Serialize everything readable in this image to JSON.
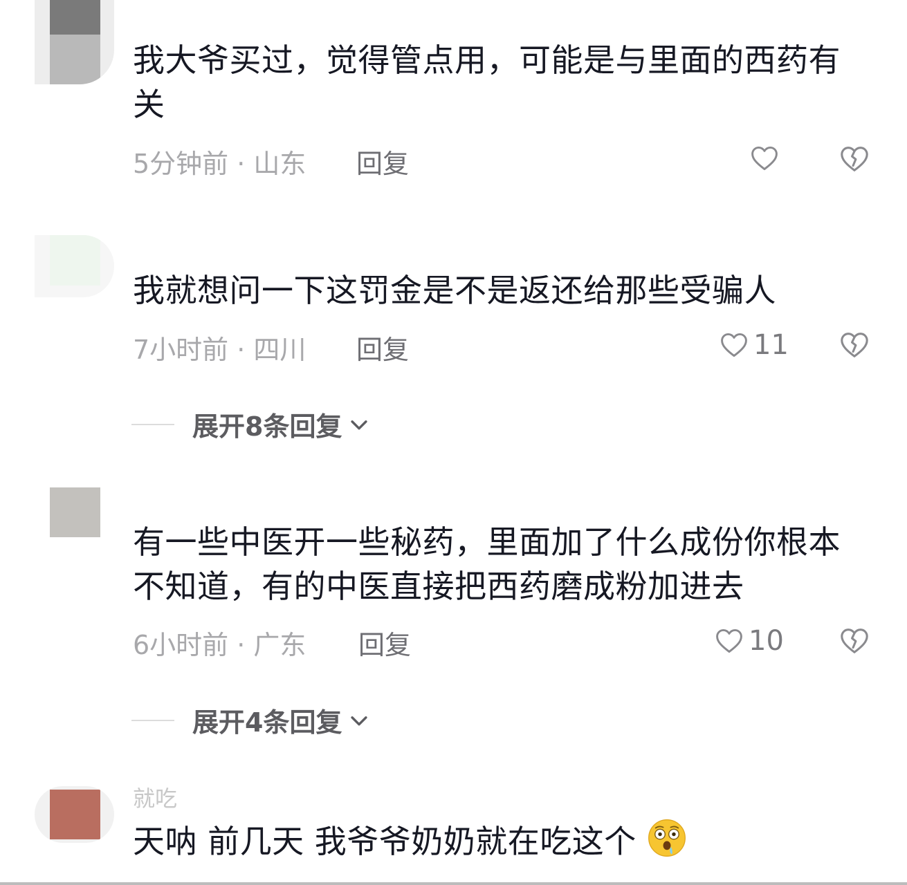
{
  "comments": [
    {
      "avatar_color": "#7a7a7a",
      "username": "",
      "text": "我大爷买过，觉得管点用，可能是与里面的西药有关",
      "time": "5分钟前",
      "location": "山东",
      "meta": "5分钟前 · 山东",
      "reply_label": "回复",
      "likes": "",
      "liked": false
    },
    {
      "avatar_color": "#eef6ee",
      "username": "",
      "text": "我就想问一下这罚金是不是返还给那些受骗人",
      "time": "7小时前",
      "location": "四川",
      "meta": "7小时前 · 四川",
      "reply_label": "回复",
      "likes": "11",
      "liked": false,
      "expand_label": "展开8条回复"
    },
    {
      "avatar_color": "#c3c1bd",
      "username": "",
      "text": "有一些中医开一些秘药，里面加了什么成份你根本不知道，有的中医直接把西药磨成粉加进去",
      "time": "6小时前",
      "location": "广东",
      "meta": "6小时前 · 广东",
      "reply_label": "回复",
      "likes": "10",
      "liked": false,
      "expand_label": "展开4条回复"
    },
    {
      "avatar_color": "#b96e60",
      "username": "就吃",
      "text": "天呐 前几天 我爷爷奶奶就在吃这个",
      "emoji": "drooling-shocked-face-emoji"
    }
  ],
  "icons": {
    "like": "heart-outline-icon",
    "dislike": "broken-heart-icon",
    "expand": "chevron-down-icon"
  },
  "colors": {
    "text_primary": "#161823",
    "text_meta": "#a8a8ab",
    "reply": "#6e6e73",
    "icon": "#8a8a8e"
  }
}
